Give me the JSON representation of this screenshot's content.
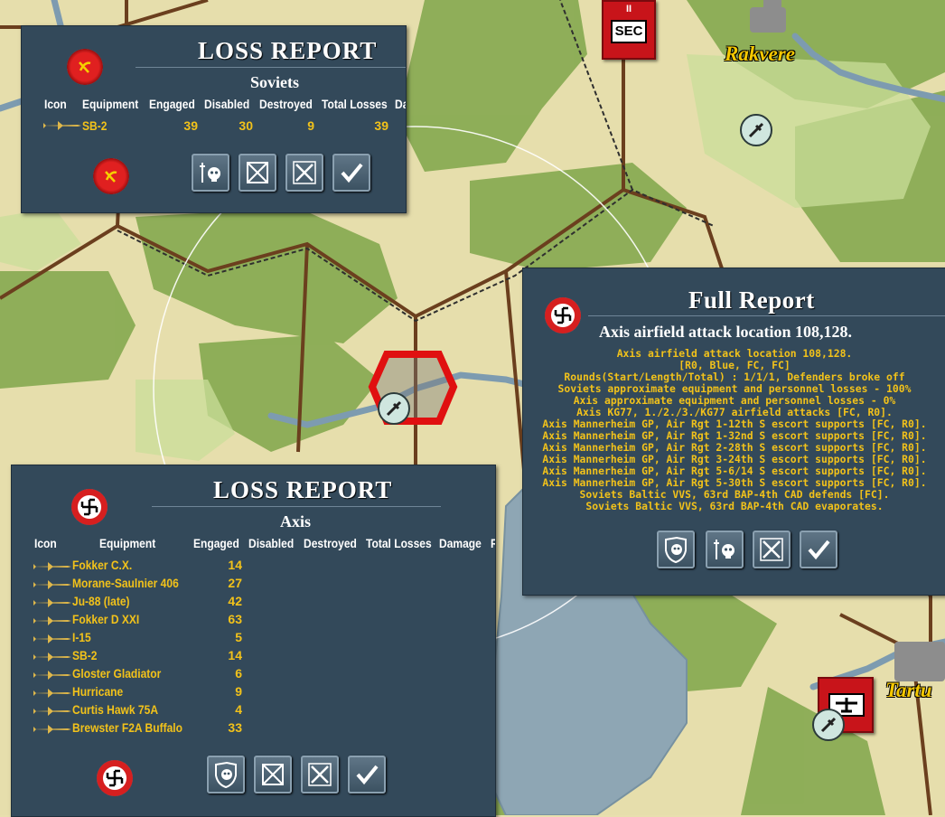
{
  "map": {
    "cities": [
      {
        "name": "Rakvere"
      },
      {
        "name": "Tartu"
      }
    ],
    "unit_sec_label": "SEC"
  },
  "soviet_loss_report": {
    "title": "LOSS REPORT",
    "side": "Soviets",
    "columns": [
      "Icon",
      "Equipment",
      "Engaged",
      "Disabled",
      "Destroyed",
      "Total Losses",
      "Da"
    ],
    "rows": [
      {
        "equipment": "SB-2",
        "engaged": "39",
        "disabled": "30",
        "destroyed": "9",
        "total_losses": "39"
      }
    ]
  },
  "axis_loss_report": {
    "title": "LOSS REPORT",
    "side": "Axis",
    "columns": [
      "Icon",
      "Equipment",
      "Engaged",
      "Disabled",
      "Destroyed",
      "Total Losses",
      "Damage",
      "R"
    ],
    "rows": [
      {
        "equipment": "Fokker C.X.",
        "engaged": "14"
      },
      {
        "equipment": "Morane-Saulnier 406",
        "engaged": "27"
      },
      {
        "equipment": "Ju-88 (late)",
        "engaged": "42"
      },
      {
        "equipment": "Fokker D XXI",
        "engaged": "63"
      },
      {
        "equipment": "I-15",
        "engaged": "5"
      },
      {
        "equipment": "SB-2",
        "engaged": "14"
      },
      {
        "equipment": "Gloster Gladiator",
        "engaged": "6"
      },
      {
        "equipment": "Hurricane",
        "engaged": "9"
      },
      {
        "equipment": "Curtis Hawk 75A",
        "engaged": "4"
      },
      {
        "equipment": "Brewster F2A Buffalo",
        "engaged": "33"
      }
    ]
  },
  "full_report": {
    "title": "Full Report",
    "subtitle": "Axis airfield attack location 108,128.",
    "lines": [
      "Axis airfield attack location 108,128.",
      "[R0, Blue, FC, FC]",
      "Rounds(Start/Length/Total) : 1/1/1, Defenders broke off",
      "Soviets approximate equipment and personnel losses - 100%",
      "Axis approximate equipment and personnel losses - 0%",
      "Axis KG77, 1./2./3./KG77 airfield attacks [FC, R0].",
      "Axis Mannerheim GP, Air Rgt 1-12th S escort supports [FC, R0].",
      "Axis Mannerheim GP, Air Rgt 1-32nd S escort supports [FC, R0].",
      "Axis Mannerheim GP, Air Rgt 2-28th S escort supports [FC, R0].",
      "Axis Mannerheim GP, Air Rgt 3-24th S escort supports [FC, R0].",
      "Axis Mannerheim GP, Air Rgt 5-6/14 S escort supports [FC, R0].",
      "Axis Mannerheim GP, Air Rgt 5-30th S escort supports [FC, R0].",
      "Soviets Baltic VVS, 63rd BAP-4th CAD defends [FC].",
      "Soviets Baltic VVS, 63rd BAP-4th CAD evaporates."
    ]
  },
  "colors": {
    "panel_bg": "#33495a",
    "data_text": "#f2c21a",
    "unit_red": "#c8141a",
    "hex_highlight": "#e01010"
  },
  "icons": [
    "soviet-emblem",
    "axis-emblem",
    "plane-icon",
    "airbase-icon",
    "skull-icon",
    "sword-skull-icon",
    "crossed-out-icon",
    "cross-swords-icon",
    "check-icon",
    "shield-skull-icon"
  ]
}
